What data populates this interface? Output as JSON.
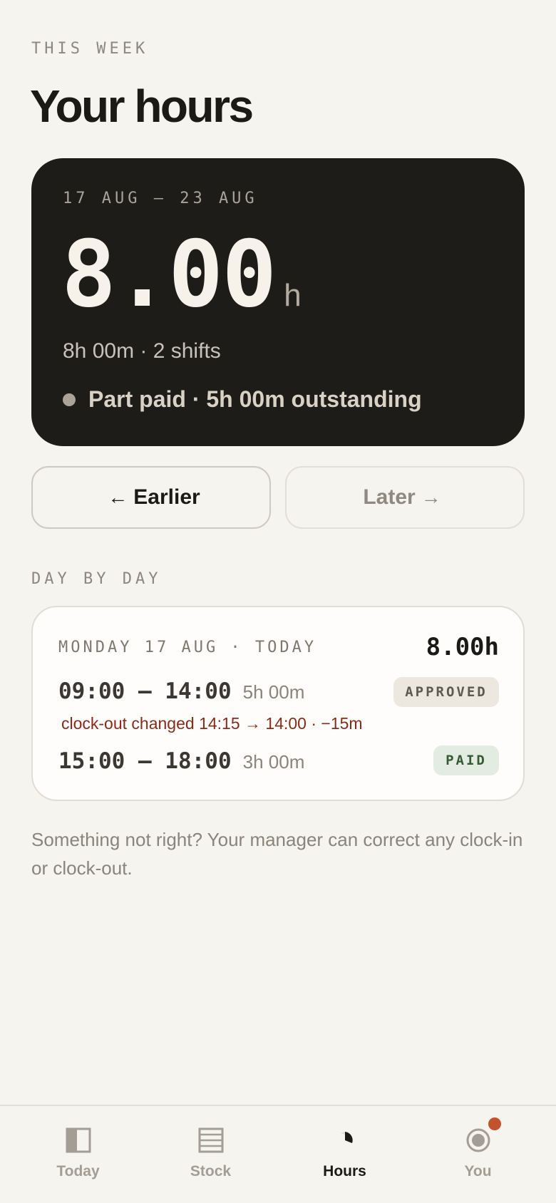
{
  "header": {
    "eyebrow": "THIS WEEK",
    "title": "Your hours"
  },
  "summary": {
    "date_range": "17 AUG — 23 AUG",
    "total_hours": "8.00",
    "unit": "h",
    "subtitle": "8h 00m · 2 shifts",
    "status_text": "Part paid · 5h 00m outstanding"
  },
  "week_nav": {
    "earlier_label": "Earlier",
    "earlier_arrow": "←",
    "later_label": "Later",
    "later_arrow": "→"
  },
  "day_by_day": {
    "section_label": "DAY BY DAY",
    "days": [
      {
        "title": "MONDAY 17 AUG · TODAY",
        "total": "8.00h",
        "shifts": [
          {
            "time": "09:00 — 14:00",
            "duration": "5h 00m",
            "status": "APPROVED",
            "note": "clock-out changed 14:15 → 14:00 · −15m"
          },
          {
            "time": "15:00 — 18:00",
            "duration": "3h 00m",
            "status": "PAID"
          }
        ]
      }
    ]
  },
  "footnote": "Something not right? Your manager can correct any clock-in or clock-out.",
  "tabbar": {
    "tabs": [
      {
        "label": "Today",
        "icon": "panel-icon",
        "active": false
      },
      {
        "label": "Stock",
        "icon": "list-icon",
        "active": false
      },
      {
        "label": "Hours",
        "icon": "clock-icon",
        "active": true
      },
      {
        "label": "You",
        "icon": "profile-icon",
        "active": false,
        "notification": true
      }
    ]
  },
  "colors": {
    "background": "#f6f4ef",
    "card_dark": "#1e1c19",
    "accent_notification": "#c4522d",
    "change_note": "#8a2a18",
    "paid_badge_bg": "#e3ece1",
    "approved_badge_bg": "#ece8df"
  }
}
